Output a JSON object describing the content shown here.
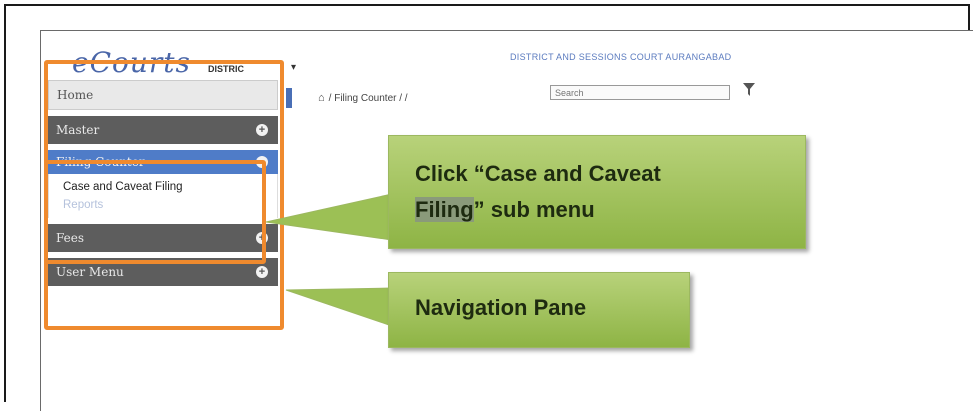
{
  "app": {
    "logo": "eCourts",
    "logo_sub": "DISTRIC",
    "court_name": "DISTRICT AND SESSIONS COURT AURANGABAD"
  },
  "breadcrumb": {
    "home_icon": "home-icon",
    "path": "/ Filing Counter /  /"
  },
  "search": {
    "placeholder": "Search"
  },
  "nav": {
    "home": "Home",
    "master": "Master",
    "filing_counter": "Filing Counter",
    "submenu": [
      "Case and Caveat Filing",
      "Reports"
    ],
    "fees": "Fees",
    "user_menu": "User Menu"
  },
  "callouts": {
    "first_line1": "Click “Case and Caveat",
    "first_word_highlight": "Filing",
    "first_rest": "” sub menu",
    "second": "Navigation Pane"
  },
  "colors": {
    "accent_orange": "#ef8a2e",
    "callout_green": "#9dc254",
    "nav_blue": "#4f7cc8"
  }
}
